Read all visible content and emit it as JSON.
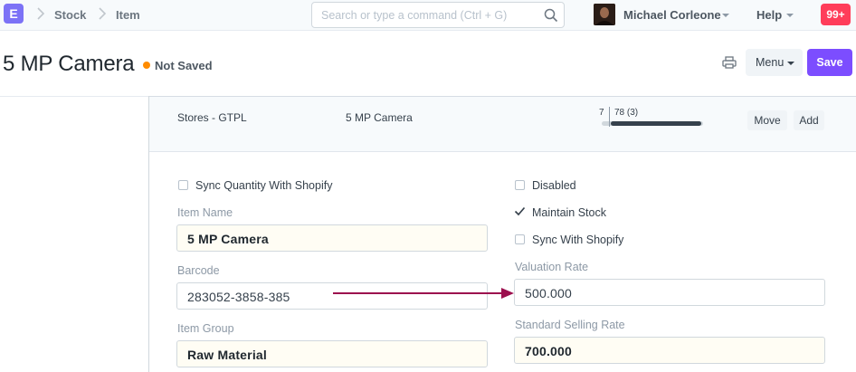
{
  "navbar": {
    "logo": "E",
    "breadcrumbs": [
      "Stock",
      "Item"
    ],
    "search_placeholder": "Search or type a command (Ctrl + G)",
    "user_name": "Michael Corleone",
    "help_label": "Help",
    "notification_count": "99+"
  },
  "page": {
    "title": "5 MP Camera",
    "status": "Not Saved",
    "status_color": "#ff8c00",
    "menu_label": "Menu",
    "save_label": "Save",
    "save_color": "#7c4dff"
  },
  "stock_row": {
    "warehouse": "Stores - GTPL",
    "item": "5 MP Camera",
    "qty_left": "7",
    "qty_right": "78 (3)",
    "move_label": "Move",
    "add_label": "Add"
  },
  "form": {
    "sync_qty_label": "Sync Quantity With Shopify",
    "sync_qty_checked": false,
    "item_name_label": "Item Name",
    "item_name_value": "5 MP Camera",
    "barcode_label": "Barcode",
    "barcode_value": "283052-3858-385",
    "item_group_label": "Item Group",
    "item_group_value": "Raw Material",
    "disabled_label": "Disabled",
    "disabled_checked": false,
    "maintain_stock_label": "Maintain Stock",
    "maintain_stock_checked": true,
    "sync_shopify_label": "Sync With Shopify",
    "sync_shopify_checked": false,
    "valuation_rate_label": "Valuation Rate",
    "valuation_rate_value": "500.000",
    "selling_rate_label": "Standard Selling Rate",
    "selling_rate_value": "700.000"
  },
  "annotation": {
    "arrow_color": "#9c0f4e"
  }
}
